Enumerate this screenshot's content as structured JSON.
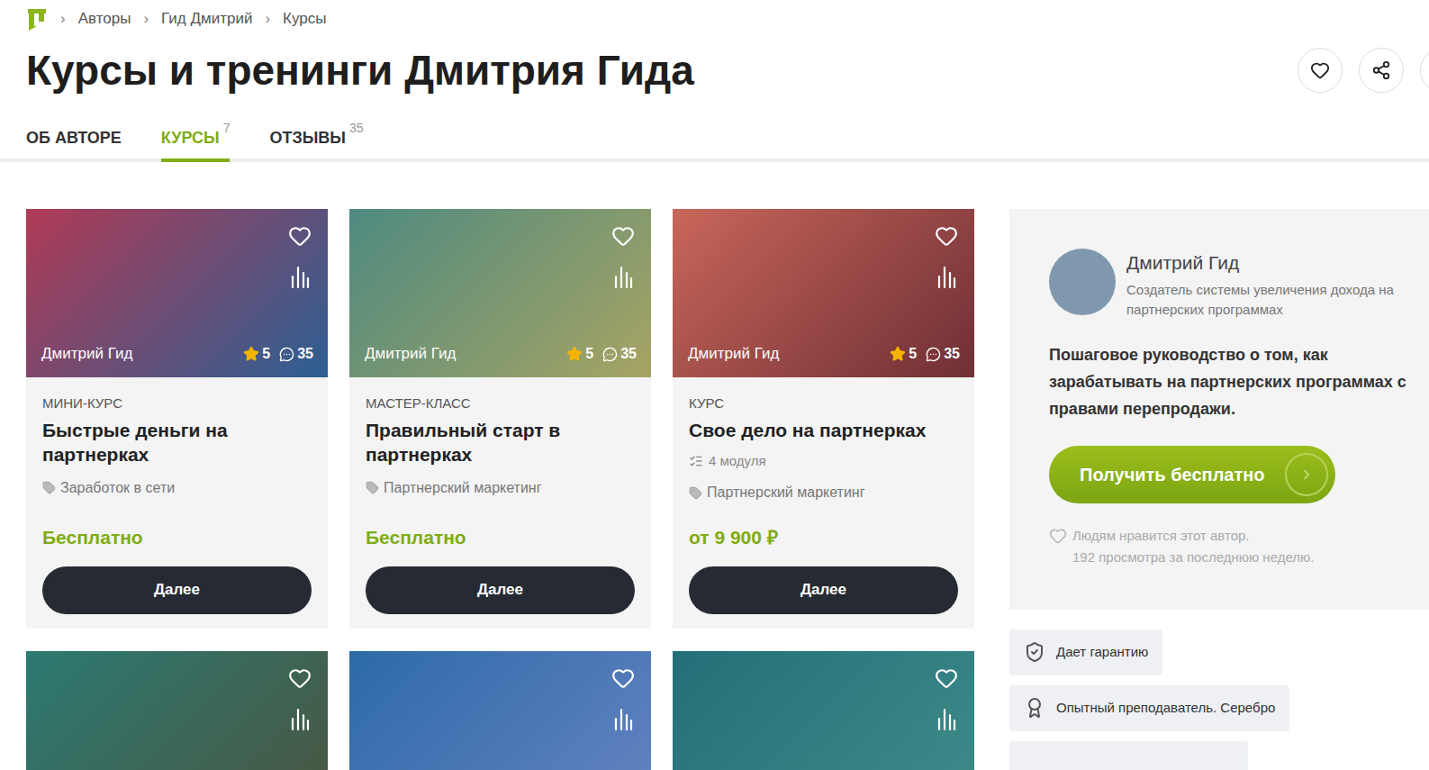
{
  "breadcrumb": {
    "separator": "›",
    "items": [
      "Авторы",
      "Гид Дмитрий",
      "Курсы"
    ]
  },
  "title": "Курсы и тренинги Дмитрия Гида",
  "tabs": [
    {
      "label": "ОБ АВТОРЕ",
      "count": "",
      "selected": false
    },
    {
      "label": "КУРСЫ",
      "count": "7",
      "selected": true
    },
    {
      "label": "ОТЗЫВЫ",
      "count": "35",
      "selected": false
    }
  ],
  "courses": [
    {
      "author": "Дмитрий Гид",
      "rating": "5",
      "reviews": "35",
      "type": "МИНИ-КУРС",
      "title": "Быстрые деньги на партнерках",
      "modules": "",
      "category": "Заработок в сети",
      "price": "Бесплатно",
      "button": "Далее",
      "color": "#b03a55",
      "color2": "#2c5f93"
    },
    {
      "author": "Дмитрий Гид",
      "rating": "5",
      "reviews": "35",
      "type": "МАСТЕР-КЛАСС",
      "title": "Правильный старт в партнерках",
      "modules": "",
      "category": "Партнерский маркетинг",
      "price": "Бесплатно",
      "button": "Далее",
      "color": "#4e8a80",
      "color2": "#a7a463"
    },
    {
      "author": "Дмитрий Гид",
      "rating": "5",
      "reviews": "35",
      "type": "КУРС",
      "title": "Свое дело на партнерках",
      "modules": "4 модуля",
      "category": "Партнерский маркетинг",
      "price": "от 9 900 ₽",
      "button": "Далее",
      "color": "#c9665a",
      "color2": "#6e2f35"
    },
    {
      "author": "",
      "rating": "",
      "reviews": "",
      "type": "",
      "title": "",
      "modules": "",
      "category": "",
      "price": "",
      "button": "",
      "color": "#2c7a72",
      "color2": "#4a5540"
    },
    {
      "author": "",
      "rating": "",
      "reviews": "",
      "type": "",
      "title": "",
      "modules": "",
      "category": "",
      "price": "",
      "button": "",
      "color": "#2d6aa8",
      "color2": "#6683c2"
    },
    {
      "author": "",
      "rating": "",
      "reviews": "",
      "type": "",
      "title": "",
      "modules": "",
      "category": "",
      "price": "",
      "button": "",
      "color": "#236f78",
      "color2": "#3f8c8a"
    }
  ],
  "sidebar": {
    "name": "Дмитрий Гид",
    "description": "Создатель системы увеличения дохода на партнерских программах",
    "pitch": "Пошаговое руководство о том, как зарабатывать на партнерских программах с правами перепродажи.",
    "button": "Получить бесплатно",
    "likes": "Людям нравится этот автор.",
    "views": "192 просмотра за последнюю неделю."
  },
  "badges": [
    {
      "label": "Дает гарантию",
      "kind": "guarantee"
    },
    {
      "label": "Опытный преподаватель. Серебро",
      "kind": "medal"
    }
  ]
}
